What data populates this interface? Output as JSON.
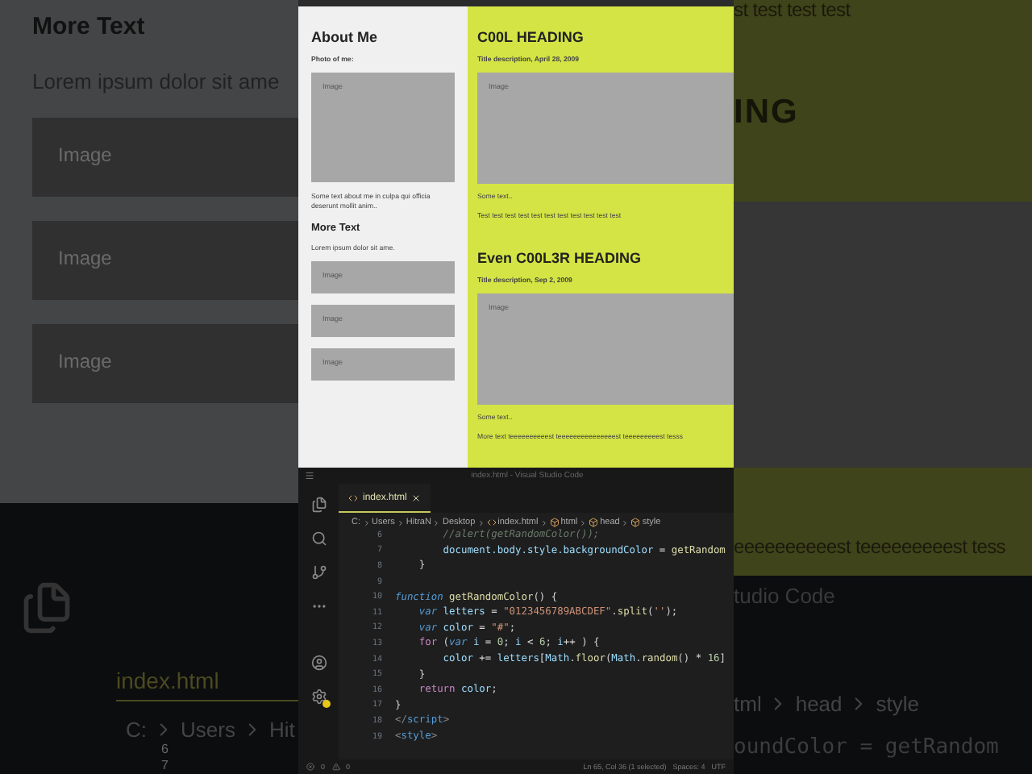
{
  "backdrop_left": {
    "heading": "More Text",
    "text": "Lorem ipsum dolor sit ame",
    "images": [
      "Image",
      "Image",
      "Image"
    ],
    "tab": "index.html",
    "breadcrumb": [
      "C:",
      "Users",
      "Hit"
    ],
    "line_numbers": [
      "6",
      "7"
    ]
  },
  "backdrop_right": {
    "top_text": "st test test test",
    "heading": "ING",
    "bottom_text": "eeeeeeeeeest teeeeeeeeest tess",
    "title": "tudio Code",
    "breadcrumb": [
      "tml",
      "head",
      "style"
    ],
    "code": "oundColor = getRandom"
  },
  "page": {
    "sidebar": {
      "title": "About Me",
      "photo_label": "Photo of me:",
      "photo": "Image",
      "about": "Some text about me in culpa qui officia deserunt mollit anim..",
      "more_title": "More Text",
      "more_text": "Lorem ipsum dolor sit ame.",
      "images": [
        "Image",
        "Image",
        "Image"
      ]
    },
    "posts": [
      {
        "heading": "C00L HEADING",
        "description": "Title description, April 28, 2009",
        "image": "Image",
        "lead": "Some text..",
        "body": "Test test test test test test test test test test test"
      },
      {
        "heading": "Even C00L3R HEADING",
        "description": "Title description, Sep 2, 2009",
        "image": "Image",
        "lead": "Some text..",
        "body": "More text teeeeeeeeeest teeeeeeeeeeeeeeest teeeeeeeeest tesss"
      }
    ]
  },
  "editor": {
    "title": "index.html - Visual Studio Code",
    "tab": {
      "label": "index.html",
      "selected": true
    },
    "breadcrumb": [
      {
        "kind": "text",
        "label": "C:"
      },
      {
        "kind": "text",
        "label": "Users"
      },
      {
        "kind": "text",
        "label": "HitraN"
      },
      {
        "kind": "text",
        "label": "Desktop"
      },
      {
        "kind": "file",
        "label": "index.html"
      },
      {
        "kind": "symbol",
        "label": "html"
      },
      {
        "kind": "symbol",
        "label": "head"
      },
      {
        "kind": "symbol",
        "label": "style"
      }
    ],
    "lines": [
      {
        "number": "6",
        "tokens": [
          {
            "kind": "comment",
            "text": "        //alert(getRandomColor());"
          }
        ]
      },
      {
        "number": "7",
        "tokens": [
          {
            "kind": "variable",
            "text": "        document.body.style.backgroundColor"
          },
          {
            "kind": "plain",
            "text": " = "
          },
          {
            "kind": "function",
            "text": "getRandom"
          }
        ]
      },
      {
        "number": "8",
        "tokens": [
          {
            "kind": "plain",
            "text": "    }"
          }
        ]
      },
      {
        "number": "9"
      },
      {
        "number": "10",
        "tokens": [
          {
            "kind": "keyword",
            "text": "function"
          },
          {
            "kind": "function",
            "text": " getRandomColor"
          },
          {
            "kind": "plain",
            "text": "() {"
          }
        ]
      },
      {
        "number": "11",
        "tokens": [
          {
            "kind": "keyword",
            "text": "    var"
          },
          {
            "kind": "variable",
            "text": " letters"
          },
          {
            "kind": "plain",
            "text": " = "
          },
          {
            "kind": "string",
            "text": "\"0123456789ABCDEF\""
          },
          {
            "kind": "plain",
            "text": "."
          },
          {
            "kind": "function",
            "text": "split"
          },
          {
            "kind": "plain",
            "text": "("
          },
          {
            "kind": "string",
            "text": "''"
          },
          {
            "kind": "plain",
            "text": ");"
          }
        ]
      },
      {
        "number": "12",
        "tokens": [
          {
            "kind": "keyword",
            "text": "    var"
          },
          {
            "kind": "variable",
            "text": " color"
          },
          {
            "kind": "plain",
            "text": " = "
          },
          {
            "kind": "string",
            "text": "\"#\""
          },
          {
            "kind": "plain",
            "text": ";"
          }
        ]
      },
      {
        "number": "13",
        "tokens": [
          {
            "kind": "control",
            "text": "    for"
          },
          {
            "kind": "plain",
            "text": " ("
          },
          {
            "kind": "keyword",
            "text": "var"
          },
          {
            "kind": "variable",
            "text": " i"
          },
          {
            "kind": "plain",
            "text": " = "
          },
          {
            "kind": "number",
            "text": "0"
          },
          {
            "kind": "plain",
            "text": "; "
          },
          {
            "kind": "variable",
            "text": "i"
          },
          {
            "kind": "plain",
            "text": " < "
          },
          {
            "kind": "number",
            "text": "6"
          },
          {
            "kind": "plain",
            "text": "; "
          },
          {
            "kind": "variable",
            "text": "i"
          },
          {
            "kind": "plain",
            "text": "++ ) {"
          }
        ]
      },
      {
        "number": "14",
        "tokens": [
          {
            "kind": "variable",
            "text": "        color"
          },
          {
            "kind": "plain",
            "text": " += "
          },
          {
            "kind": "variable",
            "text": "letters"
          },
          {
            "kind": "plain",
            "text": "["
          },
          {
            "kind": "variable",
            "text": "Math"
          },
          {
            "kind": "plain",
            "text": "."
          },
          {
            "kind": "function",
            "text": "floor"
          },
          {
            "kind": "plain",
            "text": "("
          },
          {
            "kind": "variable",
            "text": "Math"
          },
          {
            "kind": "plain",
            "text": "."
          },
          {
            "kind": "function",
            "text": "random"
          },
          {
            "kind": "plain",
            "text": "() * "
          },
          {
            "kind": "number",
            "text": "16"
          },
          {
            "kind": "plain",
            "text": "]"
          }
        ]
      },
      {
        "number": "15",
        "tokens": [
          {
            "kind": "plain",
            "text": "    }"
          }
        ]
      },
      {
        "number": "16",
        "tokens": [
          {
            "kind": "control",
            "text": "    return"
          },
          {
            "kind": "variable",
            "text": " color"
          },
          {
            "kind": "plain",
            "text": ";"
          }
        ]
      },
      {
        "number": "17",
        "tokens": [
          {
            "kind": "plain",
            "text": "}"
          }
        ]
      },
      {
        "number": "18",
        "tokens": [
          {
            "kind": "punct",
            "text": "</"
          },
          {
            "kind": "tag",
            "text": "script"
          },
          {
            "kind": "punct",
            "text": ">"
          }
        ]
      },
      {
        "number": "19",
        "tokens": [
          {
            "kind": "punct",
            "text": "<"
          },
          {
            "kind": "tag",
            "text": "style"
          },
          {
            "kind": "punct",
            "text": ">"
          }
        ]
      }
    ],
    "status": {
      "errors": "0",
      "warnings": "0",
      "position": "Ln 65, Col 36 (1 selected)",
      "spaces": "Spaces: 4",
      "encoding": "UTF"
    }
  }
}
